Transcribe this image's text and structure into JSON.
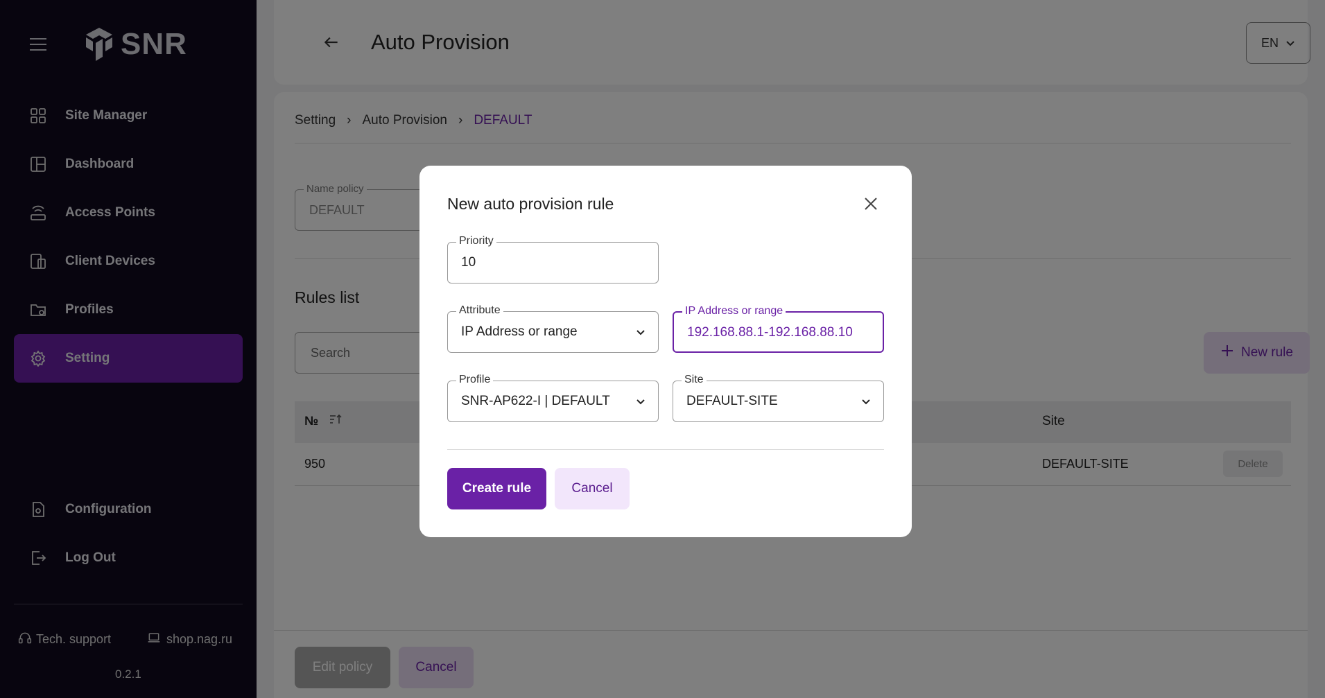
{
  "sidebar": {
    "logo_text": "SNR",
    "items": [
      {
        "label": "Site Manager",
        "icon": "grid-icon"
      },
      {
        "label": "Dashboard",
        "icon": "dashboard-icon"
      },
      {
        "label": "Access Points",
        "icon": "access-point-icon"
      },
      {
        "label": "Client Devices",
        "icon": "devices-icon"
      },
      {
        "label": "Profiles",
        "icon": "folder-settings-icon"
      },
      {
        "label": "Setting",
        "icon": "gear-icon"
      }
    ],
    "bottom_items": [
      {
        "label": "Configuration",
        "icon": "config-file-icon"
      },
      {
        "label": "Log Out",
        "icon": "logout-icon"
      }
    ],
    "support_label": "Tech. support",
    "shop_label": "shop.nag.ru",
    "version": "0.2.1",
    "active_color": "#6a21a6"
  },
  "header": {
    "title": "Auto Provision",
    "language": "EN"
  },
  "breadcrumb": {
    "items": [
      "Setting",
      "Auto Provision"
    ],
    "current": "DEFAULT"
  },
  "policy": {
    "name_label": "Name policy",
    "name_value": "DEFAULT"
  },
  "rules": {
    "title": "Rules list",
    "search_placeholder": "Search",
    "new_rule_label": "New rule",
    "columns": {
      "no": "№",
      "site": "Site"
    },
    "rows": [
      {
        "no": "950",
        "site": "DEFAULT-SITE",
        "delete_label": "Delete"
      }
    ]
  },
  "footer": {
    "edit_label": "Edit policy",
    "cancel_label": "Cancel"
  },
  "modal": {
    "title": "New auto provision rule",
    "priority_label": "Priority",
    "priority_value": "10",
    "attribute_label": "Attribute",
    "attribute_value": "IP Address or range",
    "ip_label": "IP Address or range",
    "ip_value": "192.168.88.1-192.168.88.10",
    "profile_label": "Profile",
    "profile_value": "SNR-AP622-I | DEFAULT",
    "site_label": "Site",
    "site_value": "DEFAULT-SITE",
    "create_label": "Create rule",
    "cancel_label": "Cancel"
  }
}
